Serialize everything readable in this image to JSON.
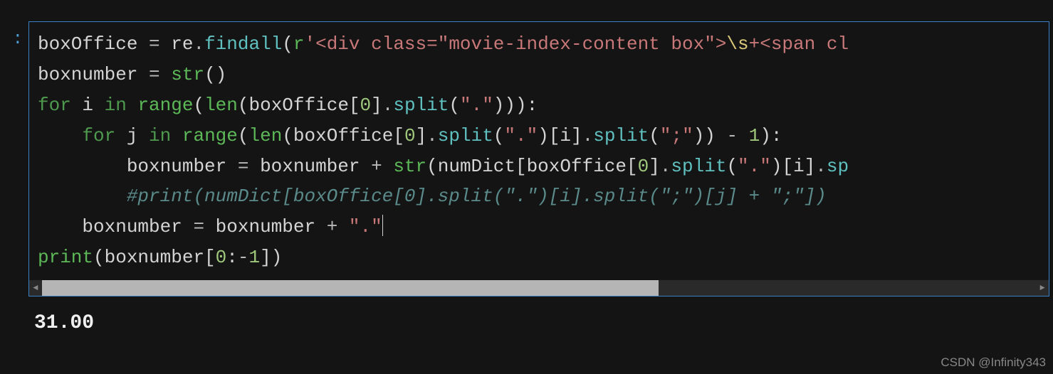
{
  "prompt": ":",
  "code": {
    "line1": {
      "var1": "boxOffice ",
      "op1": "=",
      "mod": " re",
      "dot1": ".",
      "fn1": "findall",
      "paren1": "(",
      "raw": "r",
      "str1": "'<div class=\"movie-index-content box\">",
      "esc1": "\\s",
      "str2": "+<span cl"
    },
    "line2": {
      "var1": "boxnumber ",
      "op1": "=",
      "sp": " ",
      "fn1": "str",
      "paren1": "()"
    },
    "line3": {
      "kw1": "for",
      "var1": " i ",
      "kw2": "in",
      "sp1": " ",
      "fn1": "range",
      "paren1": "(",
      "fn2": "len",
      "paren2": "(",
      "var2": "boxOffice[",
      "num1": "0",
      "var3": "]",
      "dot1": ".",
      "fn3": "split",
      "paren3": "(",
      "str1": "\".\"",
      "paren4": "))):"
    },
    "line4": {
      "indent": "    ",
      "kw1": "for",
      "var1": " j ",
      "kw2": "in",
      "sp1": " ",
      "fn1": "range",
      "paren1": "(",
      "fn2": "len",
      "paren2": "(",
      "var2": "boxOffice[",
      "num1": "0",
      "var3": "]",
      "dot1": ".",
      "fn3": "split",
      "paren3": "(",
      "str1": "\".\"",
      "paren4": ")[i]",
      "dot2": ".",
      "fn4": "split",
      "paren5": "(",
      "str2": "\";\"",
      "paren6": ")) ",
      "op1": "-",
      "sp2": " ",
      "num2": "1",
      "paren7": "):"
    },
    "line5": {
      "indent": "        ",
      "var1": "boxnumber ",
      "op1": "=",
      "var2": " boxnumber ",
      "op2": "+",
      "sp1": " ",
      "fn1": "str",
      "paren1": "(numDict[boxOffice[",
      "num1": "0",
      "var3": "]",
      "dot1": ".",
      "fn2": "split",
      "paren2": "(",
      "str1": "\".\"",
      "paren3": ")[i]",
      "dot2": ".",
      "fn3": "sp"
    },
    "line6": {
      "indent": "        ",
      "comment": "#print(numDict[boxOffice[0].split(\".\")[i].split(\";\")[j] + \";\"])"
    },
    "line7": {
      "indent": "    ",
      "var1": "boxnumber ",
      "op1": "=",
      "var2": " boxnumber ",
      "op2": "+",
      "sp1": " ",
      "str1": "\".\""
    },
    "line8": {
      "fn1": "print",
      "paren1": "(boxnumber[",
      "num1": "0",
      "slice1": ":",
      "op1": "-",
      "num2": "1",
      "paren2": "])"
    }
  },
  "output": "31.00",
  "watermark": "CSDN @Infinity343"
}
